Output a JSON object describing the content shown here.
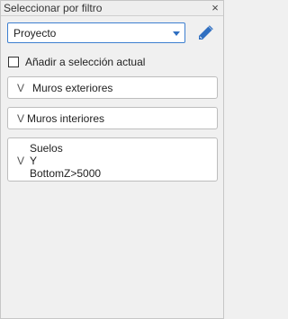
{
  "window": {
    "title": "Seleccionar por filtro",
    "close_glyph": "×"
  },
  "category_dropdown": {
    "selected": "Proyecto",
    "arrow_icon": "chevron-down-icon",
    "accent_color": "#2f6fc1"
  },
  "edit_button": {
    "icon": "pencil-icon"
  },
  "add_to_selection": {
    "label": "Añadir a selección actual",
    "checked": false
  },
  "filters": [
    {
      "operator": "V",
      "lines": [
        "Muros exteriores"
      ]
    },
    {
      "operator": "V",
      "lines": [
        "Muros interiores"
      ]
    },
    {
      "operator": "V",
      "lines": [
        "Suelos",
        "Y",
        "BottomZ>5000"
      ]
    }
  ]
}
